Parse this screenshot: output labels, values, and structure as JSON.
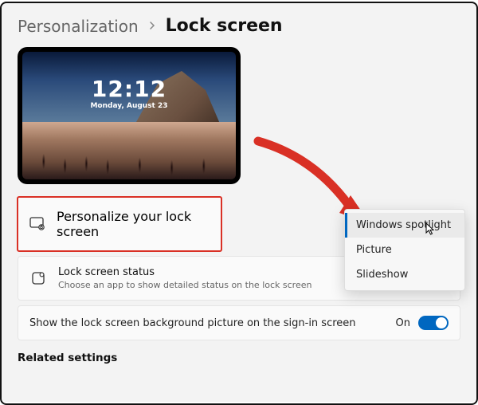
{
  "breadcrumb": {
    "parent": "Personalization",
    "current": "Lock screen"
  },
  "preview": {
    "time": "12:12",
    "date": "Monday, August 23"
  },
  "rows": {
    "personalize": {
      "title": "Personalize your lock screen"
    },
    "status": {
      "title": "Lock screen status",
      "sub": "Choose an app to show detailed status on the lock screen"
    },
    "signin": {
      "label": "Show the lock screen background picture on the sign-in screen",
      "state": "On"
    }
  },
  "dropdown": {
    "options": [
      "Windows spotlight",
      "Picture",
      "Slideshow"
    ],
    "selected_index": 0
  },
  "related_heading": "Related settings",
  "colors": {
    "accent": "#0067c0",
    "highlight": "#d93025"
  }
}
